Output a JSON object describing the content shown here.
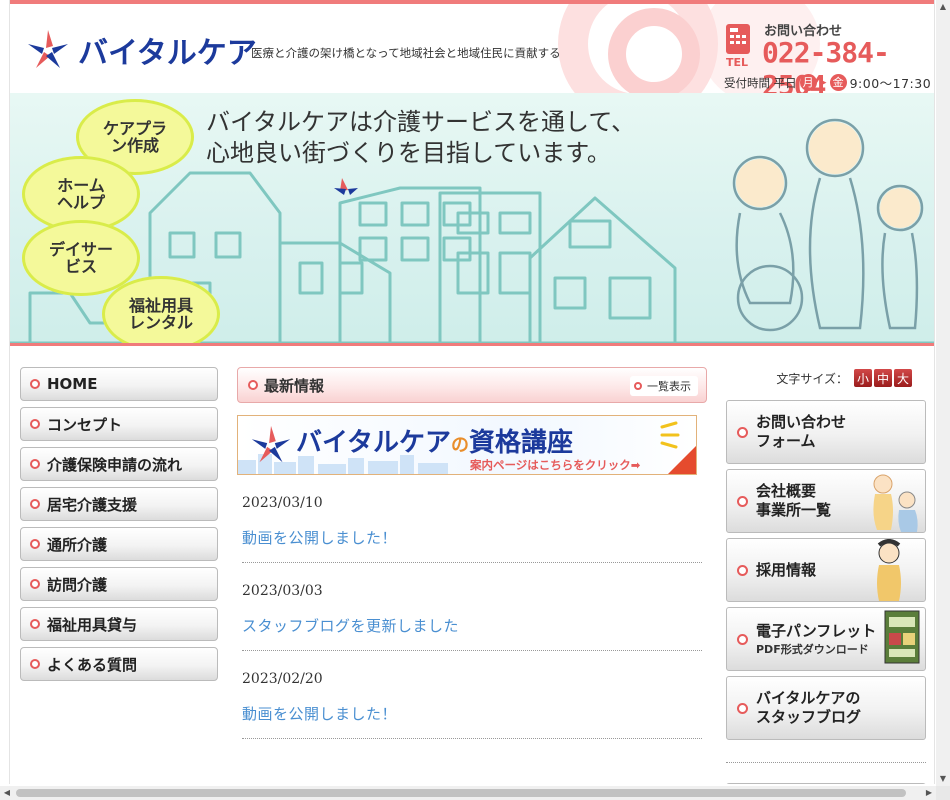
{
  "header": {
    "brand": "バイタルケア",
    "tagline": "医療と介護の架け橋となって地域社会と地域住民に貢献する",
    "contact_label": "お問い合わせ",
    "phone": "022-384-2504",
    "hours_label": "受付時間 平日",
    "hours_from": "月",
    "hours_to": "金",
    "hours_time": "9:00〜17:30"
  },
  "hero": {
    "headline_line1": "バイタルケアは介護サービスを通して、",
    "headline_line2": "心地良い街づくりを目指しています。",
    "circles": [
      "ケアプラン作成",
      "ホームヘルプ",
      "デイサービス",
      "福祉用具レンタル"
    ]
  },
  "leftnav": {
    "items": [
      {
        "label": "HOME"
      },
      {
        "label": "コンセプト"
      },
      {
        "label": "介護保険申請の流れ"
      },
      {
        "label": "居宅介護支援"
      },
      {
        "label": "通所介護"
      },
      {
        "label": "訪問介護"
      },
      {
        "label": "福祉用具貸与"
      },
      {
        "label": "よくある質問"
      }
    ]
  },
  "news": {
    "heading": "最新情報",
    "list_button": "一覧表示",
    "banner_brand": "バイタルケア",
    "banner_no": "の",
    "banner_title": "資格講座",
    "banner_cta": "案内ページはこちらをクリック➡",
    "items": [
      {
        "date": "2023/03/10",
        "title": "動画を公開しました！"
      },
      {
        "date": "2023/03/03",
        "title": "スタッフブログを更新しました"
      },
      {
        "date": "2023/02/20",
        "title": "動画を公開しました！"
      }
    ]
  },
  "right": {
    "font_size_label": "文字サイズ：",
    "font_sizes": [
      "小",
      "中",
      "大"
    ],
    "buttons": [
      {
        "label": "お問い合わせ\nフォーム",
        "sub": ""
      },
      {
        "label": "会社概要\n事業所一覧",
        "sub": ""
      },
      {
        "label": "採用情報",
        "sub": ""
      },
      {
        "label": "電子パンフレット",
        "sub": "PDF形式ダウンロード"
      },
      {
        "label": "バイタルケアの\nスタッフブログ",
        "sub": ""
      }
    ]
  },
  "colors": {
    "accent": "#e65b5b",
    "brand_blue": "#1c3a9c",
    "link": "#4a8fd1"
  }
}
